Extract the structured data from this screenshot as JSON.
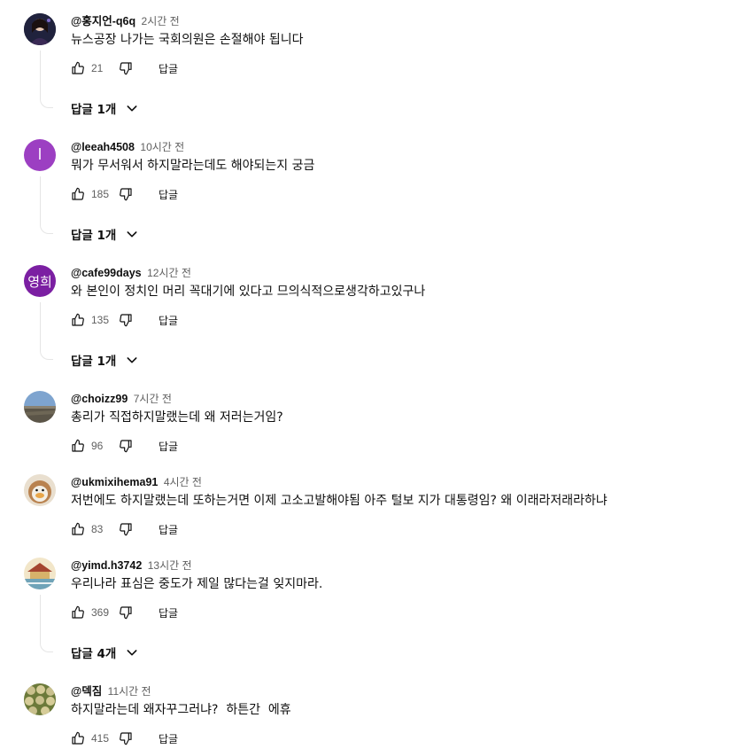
{
  "ui": {
    "reply_label": "답글",
    "colors": {
      "text_primary": "#0f0f0f",
      "text_secondary": "#606060",
      "thread_line": "#e5e5e5"
    },
    "icons": [
      "thumbs-up-icon",
      "thumbs-down-icon",
      "chevron-down-icon"
    ]
  },
  "comments": [
    {
      "author": "@홍지언-q6q",
      "time": "2시간 전",
      "text": "뉴스공장 나가는 국회의원은 손절해야 됩니다",
      "likes": "21",
      "replies": "답글 1개",
      "avatar": {
        "type": "photo",
        "initial": ""
      }
    },
    {
      "author": "@leeah4508",
      "time": "10시간 전",
      "text": "뭐가 무서워서 하지말라는데도 해야되는지 궁금",
      "likes": "185",
      "replies": "답글 1개",
      "avatar": {
        "type": "initial",
        "initial": "l",
        "color": "#9c3fc2"
      }
    },
    {
      "author": "@cafe99days",
      "time": "12시간 전",
      "text": "와 본인이 정치인 머리 꼭대기에 있다고 므의식적으로생각하고있구나",
      "likes": "135",
      "replies": "답글 1개",
      "avatar": {
        "type": "initial",
        "initial": "영희",
        "color": "#7b1fa2"
      }
    },
    {
      "author": "@choizz99",
      "time": "7시간 전",
      "text": "총리가 직접하지말랬는데 왜 저러는거임?",
      "likes": "96",
      "replies": "",
      "avatar": {
        "type": "landscape",
        "initial": ""
      }
    },
    {
      "author": "@ukmixihema91",
      "time": "4시간 전",
      "text": "저번에도 하지말랬는데 또하는거면 이제 고소고발해야됨 아주 털보 지가 대통령임? 왜 이래라저래라하냐",
      "likes": "83",
      "replies": "",
      "avatar": {
        "type": "duck",
        "initial": ""
      }
    },
    {
      "author": "@yimd.h3742",
      "time": "13시간 전",
      "text": "우리나라 표심은 중도가 제일 많다는걸 잊지마라.",
      "likes": "369",
      "replies": "답글 4개",
      "avatar": {
        "type": "temple",
        "initial": ""
      }
    },
    {
      "author": "@덱짐",
      "time": "11시간 전",
      "text": "하지말라는데 왜자꾸그러냐?  하튼간  에휴",
      "likes": "415",
      "replies": "",
      "avatar": {
        "type": "pattern",
        "initial": ""
      }
    }
  ]
}
